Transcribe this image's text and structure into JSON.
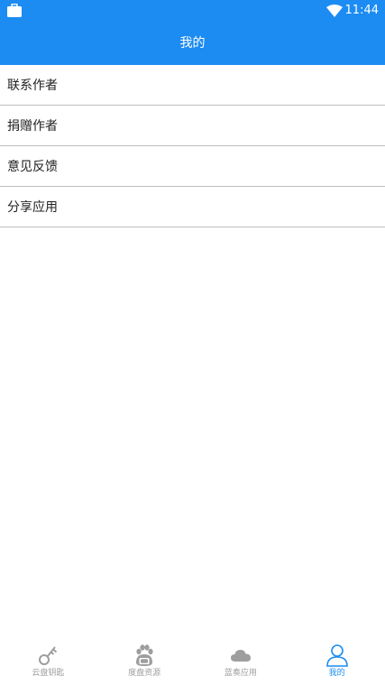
{
  "status_bar": {
    "time": "11:44"
  },
  "header": {
    "title": "我的"
  },
  "menu": {
    "items": [
      {
        "label": "联系作者"
      },
      {
        "label": "捐赠作者"
      },
      {
        "label": "意见反馈"
      },
      {
        "label": "分享应用"
      }
    ]
  },
  "bottom_nav": {
    "items": [
      {
        "label": "云盘钥匙",
        "icon": "key-icon"
      },
      {
        "label": "度盘资源",
        "icon": "paw-icon"
      },
      {
        "label": "蓝奏应用",
        "icon": "cloud-icon"
      },
      {
        "label": "我的",
        "icon": "user-icon",
        "active": true
      }
    ]
  },
  "colors": {
    "primary": "#1c8cf2",
    "inactive": "#9e9e9e",
    "divider": "#bdbdbd"
  }
}
